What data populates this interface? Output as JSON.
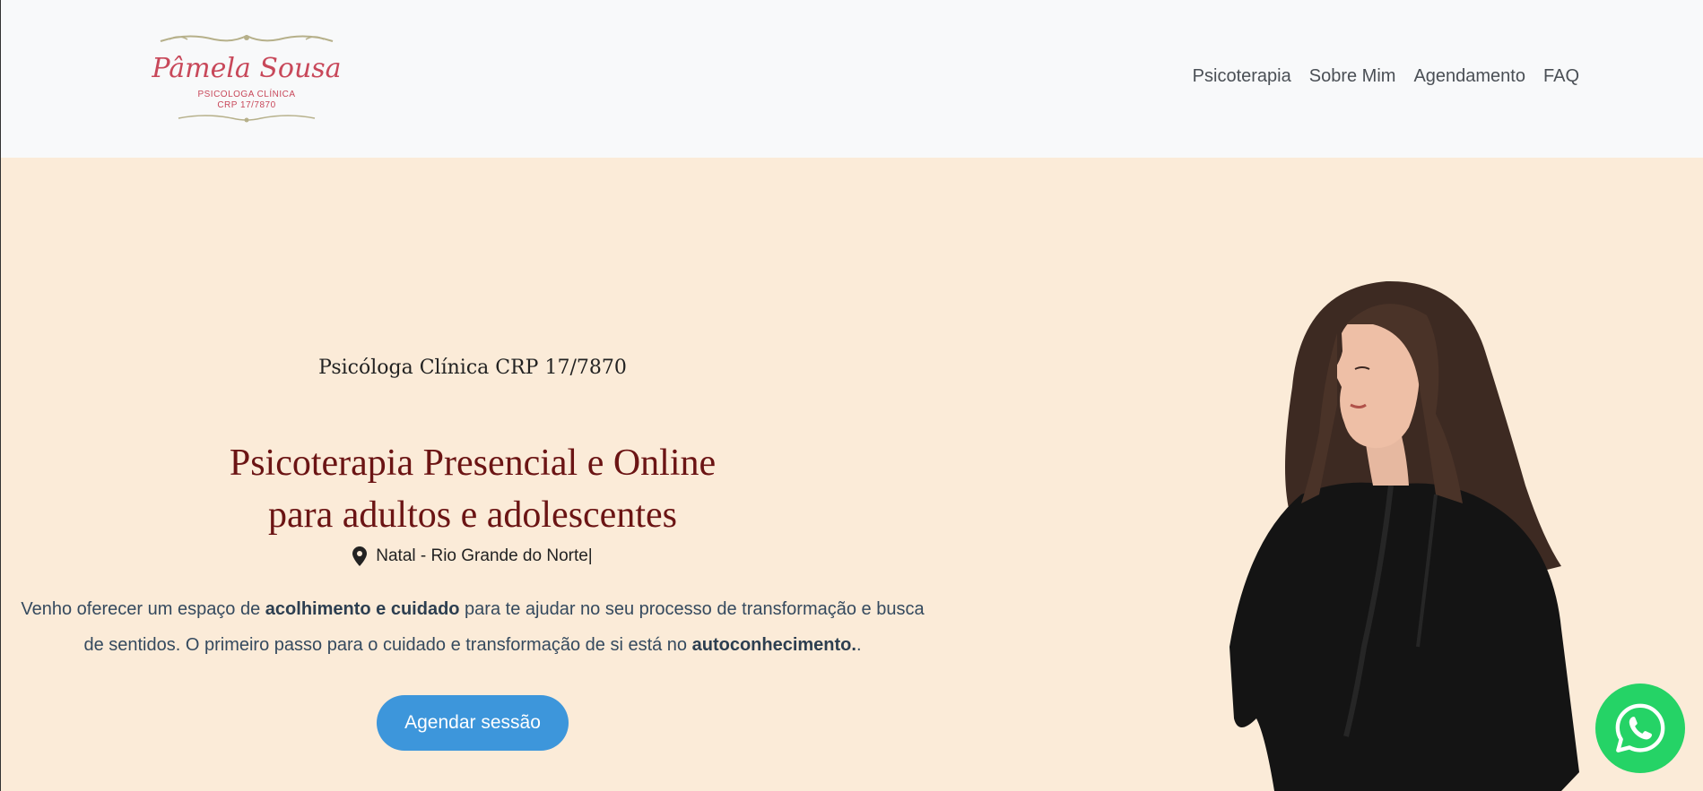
{
  "logo": {
    "name": "Pâmela Sousa",
    "line1": "PSICOLOGA CLÍNICA",
    "line2": "CRP 17/7870"
  },
  "nav": {
    "items": [
      {
        "label": "Psicoterapia"
      },
      {
        "label": "Sobre Mim"
      },
      {
        "label": "Agendamento"
      },
      {
        "label": "FAQ"
      }
    ]
  },
  "hero": {
    "subtitle": "Psicóloga Clínica CRP 17/7870",
    "headline_line1": "Psicoterapia Presencial e Online",
    "headline_line2": "para adultos e adolescentes",
    "location": "Natal - Rio Grande do Norte|",
    "intro": {
      "part1": "Venho oferecer um espaço de ",
      "bold1": "acolhimento e cuidado",
      "part2": " para te ajudar no seu processo de transformação e busca de sentidos. O primeiro passo para o cuidado e transformação de si está no ",
      "bold2": "autoconhecimento.",
      "part3": "."
    },
    "cta_label": "Agendar sessão"
  },
  "colors": {
    "hero_bg": "#fbebd8",
    "headline": "#6b1414",
    "cta": "#3d96db",
    "whatsapp": "#25d366",
    "logo_script": "#c8485a"
  },
  "icons": {
    "location": "map-marker-icon",
    "whatsapp": "whatsapp-icon"
  }
}
